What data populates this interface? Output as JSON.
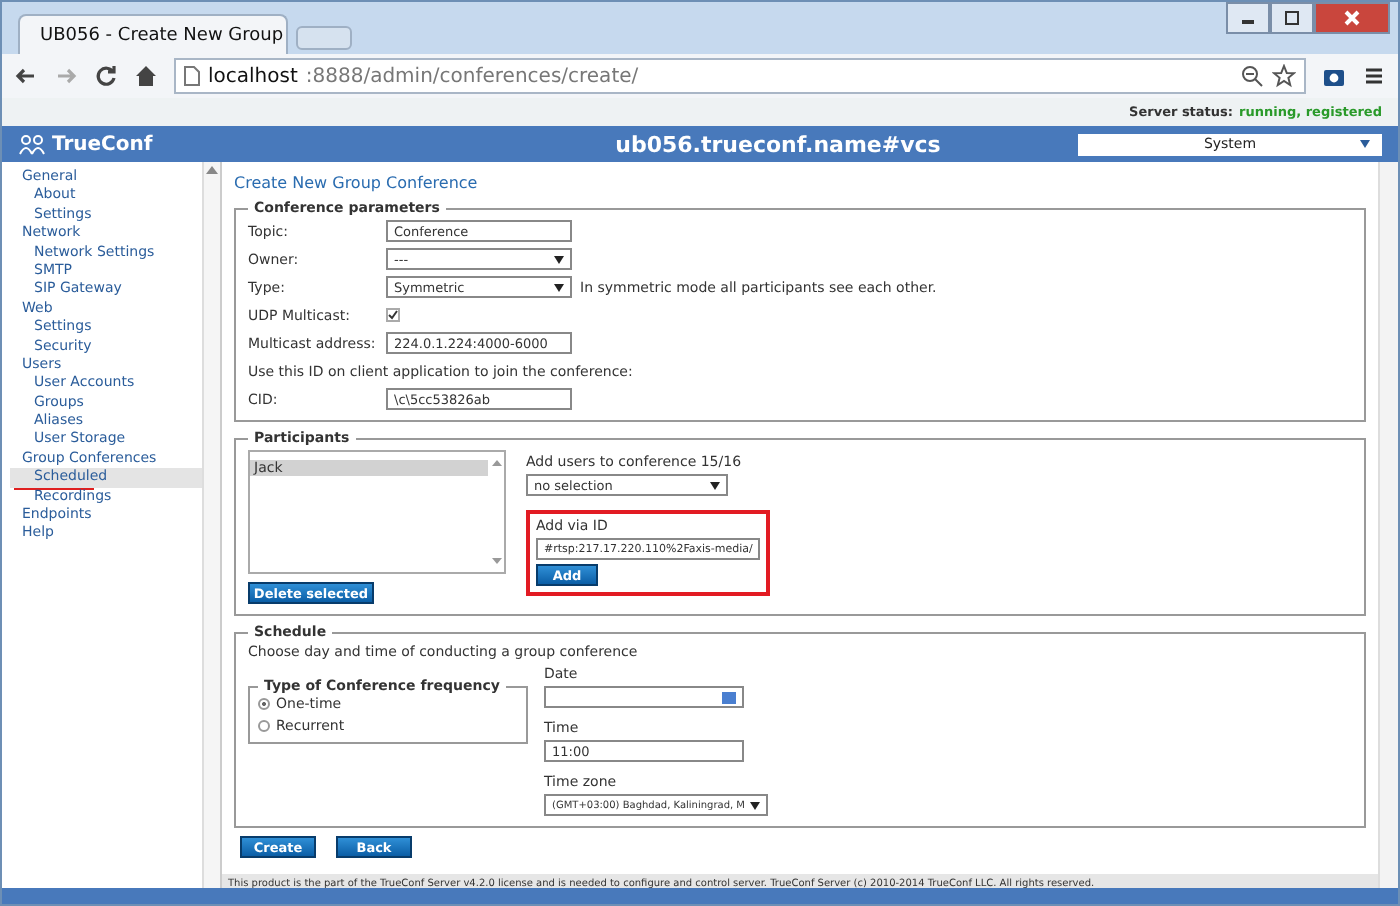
{
  "browser": {
    "tab_title": "UB056 - Create New Group",
    "address_host": "localhost",
    "address_path": ":8888/admin/conferences/create/"
  },
  "server_status": {
    "label": "Server status:",
    "value": "running, registered"
  },
  "header": {
    "logo": "TrueConf",
    "title": "ub056.trueconf.name#vcs",
    "system_select": "System"
  },
  "sidebar": {
    "items": [
      {
        "label": "General",
        "selected": false,
        "children": [
          {
            "label": "About",
            "selected": false
          },
          {
            "label": "Settings",
            "selected": false
          }
        ]
      },
      {
        "label": "Network",
        "selected": false,
        "children": [
          {
            "label": "Network Settings",
            "selected": false
          },
          {
            "label": "SMTP",
            "selected": false
          },
          {
            "label": "SIP Gateway",
            "selected": false
          }
        ]
      },
      {
        "label": "Web",
        "selected": false,
        "children": [
          {
            "label": "Settings",
            "selected": false
          },
          {
            "label": "Security",
            "selected": false
          }
        ]
      },
      {
        "label": "Users",
        "selected": false,
        "children": [
          {
            "label": "User Accounts",
            "selected": false
          },
          {
            "label": "Groups",
            "selected": false
          },
          {
            "label": "Aliases",
            "selected": false
          },
          {
            "label": "User Storage",
            "selected": false
          }
        ]
      },
      {
        "label": "Group Conferences",
        "selected": false,
        "children": [
          {
            "label": "Scheduled",
            "selected": true
          },
          {
            "label": "Recordings",
            "selected": false
          }
        ]
      },
      {
        "label": "Endpoints",
        "selected": false
      },
      {
        "label": "Help",
        "selected": false
      }
    ]
  },
  "page_title": "Create New Group Conference",
  "conference_parameters": {
    "legend": "Conference parameters",
    "rows": [
      {
        "kind": "text",
        "label": "Topic:",
        "value": "Conference"
      },
      {
        "kind": "select",
        "label": "Owner:",
        "value": "---"
      },
      {
        "kind": "select",
        "label": "Type:",
        "value": "Symmetric",
        "note": "In symmetric mode all participants see each other."
      },
      {
        "kind": "checkbox",
        "label": "UDP Multicast:",
        "checked": true
      },
      {
        "kind": "text",
        "label": "Multicast address:",
        "value": "224.0.1.224:4000-6000"
      },
      {
        "kind": "hint",
        "label": "Use this ID on client application to join the conference:"
      },
      {
        "kind": "text",
        "label": "CID:",
        "value": "\\c\\5cc53826ab"
      }
    ]
  },
  "participants": {
    "legend": "Participants",
    "list": [
      {
        "name": "Jack",
        "selected": true
      }
    ],
    "delete_button": "Delete selected",
    "add_users_label": "Add users to conference 15/16",
    "add_users_select": "no selection",
    "add_via_id_label": "Add via ID",
    "add_via_id_value": "#rtsp:217.17.220.110%2Faxis-media/",
    "add_button": "Add"
  },
  "schedule": {
    "legend": "Schedule",
    "description": "Choose day and time of conducting a group conference",
    "frequency_legend": "Type of Conference frequency",
    "frequency_options": [
      {
        "label": "One-time",
        "selected": true
      },
      {
        "label": "Recurrent",
        "selected": false
      }
    ],
    "date_label": "Date",
    "time_label": "Time",
    "time_value": "11:00",
    "timezone_label": "Time zone",
    "timezone_value": "(GMT+03:00) Baghdad, Kaliningrad, M"
  },
  "buttons": [
    "Create",
    "Back"
  ],
  "footer": "This product is the part of the TrueConf Server v4.2.0 license and is needed to configure and control server. TrueConf Server (c) 2010-2014 TrueConf LLC. All rights reserved."
}
